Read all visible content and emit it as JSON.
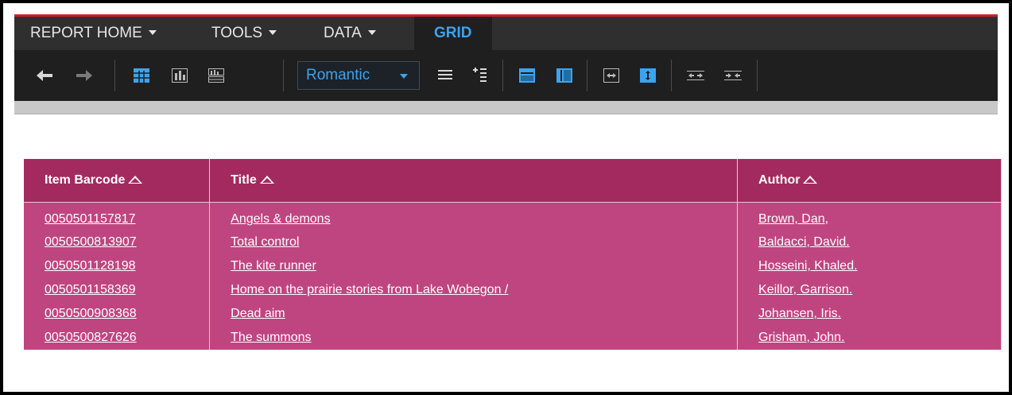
{
  "menu": {
    "items": [
      {
        "label": "REPORT HOME",
        "has_caret": true
      },
      {
        "label": "TOOLS",
        "has_caret": true
      },
      {
        "label": "DATA",
        "has_caret": true
      },
      {
        "label": "GRID",
        "active": true
      }
    ]
  },
  "toolbar": {
    "buttons": [
      {
        "icon": "undo-icon"
      },
      {
        "icon": "redo-icon"
      },
      {
        "icon": "grid-view-icon"
      },
      {
        "icon": "graph-view-icon"
      },
      {
        "icon": "grid-graph-view-icon"
      },
      {
        "icon": "outline-mode-icon"
      },
      {
        "icon": "merge-headers-icon"
      },
      {
        "icon": "banding-icon"
      },
      {
        "icon": "lock-row-headers-icon"
      },
      {
        "icon": "auto-fit-width-icon"
      },
      {
        "icon": "auto-fit-height-icon"
      },
      {
        "icon": "show-totals-icon"
      },
      {
        "icon": "subtotals-icon"
      }
    ],
    "theme_select": {
      "value": "Romantic"
    }
  },
  "grid": {
    "columns": [
      "Item Barcode",
      "Title",
      "Author"
    ],
    "rows": [
      {
        "barcode": "0050501157817",
        "title": "Angels & demons",
        "author": "Brown, Dan,"
      },
      {
        "barcode": "0050500813907",
        "title": "Total control",
        "author": "Baldacci, David."
      },
      {
        "barcode": "0050501128198",
        "title": "The kite runner",
        "author": "Hosseini, Khaled."
      },
      {
        "barcode": "0050501158369",
        "title": "Home on the prairie stories from Lake Wobegon /",
        "author": "Keillor, Garrison."
      },
      {
        "barcode": "0050500908368",
        "title": "Dead aim",
        "author": "Johansen, Iris."
      },
      {
        "barcode": "0050500827626",
        "title": "The summons",
        "author": "Grisham, John."
      }
    ]
  },
  "colors": {
    "header_bg": "#a32a5f",
    "row_bg": "#bf4580",
    "accent_blue": "#3da3ee",
    "menubar_bg": "#2f2f2f",
    "toolbar_bg": "#1f1f1f",
    "top_line": "#c8232a"
  }
}
